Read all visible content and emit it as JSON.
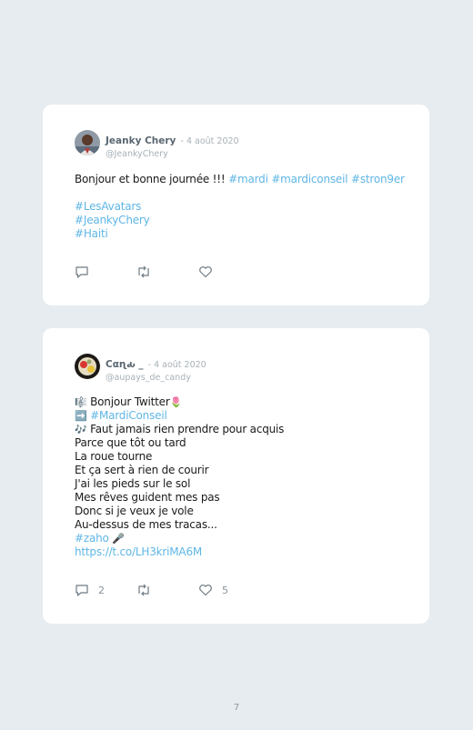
{
  "tweets": [
    {
      "name": "Jeanky Chery",
      "date": "- 4 août 2020",
      "handle": "@JeankyChery",
      "text_main": "Bonjour et bonne journée !!!",
      "tags_inline": [
        "#mardi",
        "#mardiconseil",
        "#stron9er"
      ],
      "tags_block": [
        "#LesAvatars",
        "#JeankyChery",
        "#Haiti"
      ],
      "replies": "",
      "likes": ""
    },
    {
      "name": "Cαɳԃ _",
      "date": "- 4 août 2020",
      "handle": "@aupays_de_candy",
      "lines": [
        "Bonjour Twitter",
        "#MardiConseil",
        "Faut jamais rien prendre pour acquis",
        "Parce que tôt ou tard",
        "La roue tourne",
        "Et ça sert à rien de courir",
        "J'ai les pieds sur le sol",
        "Mes rêves guident mes pas",
        "Donc si je veux je vole",
        "Au-dessus de mes tracas...",
        "#zaho",
        "https://t.co/LH3kriMA6M"
      ],
      "emoji": [
        "🎼",
        "🌷",
        "➡️",
        "🎶",
        "🎤"
      ],
      "replies": "2",
      "likes": "5"
    }
  ],
  "icons": [
    "reply-icon",
    "retweet-icon",
    "like-icon"
  ],
  "colors": {
    "background": "#e6ecef",
    "card": "#ffffff",
    "hashtag": "#5fb6e6",
    "meta": "#a7b1b7"
  },
  "page_number": "7"
}
